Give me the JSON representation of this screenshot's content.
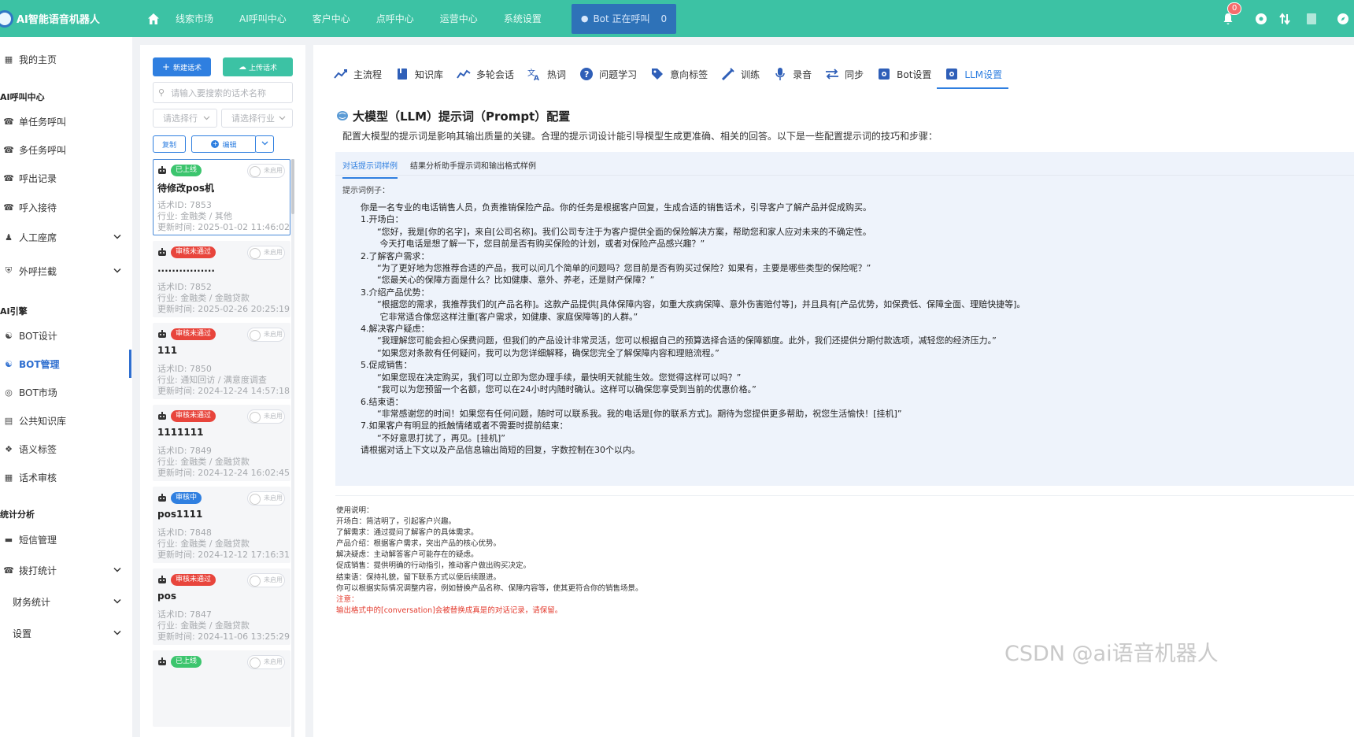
{
  "header": {
    "brand": "AI智能语音机器人",
    "nav": [
      "线索市场",
      "AI呼叫中心",
      "客户中心",
      "点呼中心",
      "运营中心",
      "系统设置"
    ],
    "bot_calling_label": "Bot 正在呼叫",
    "bot_calling_count": "0",
    "notification_count": "0",
    "accent_color": "#3cc2a4"
  },
  "sidebar": {
    "home": "我的主页",
    "groups": {
      "call_center": "AI呼叫中心",
      "engine": "AI引擎",
      "stats": "统计分析"
    },
    "items": {
      "single_task": "单任务呼叫",
      "multi_task": "多任务呼叫",
      "call_records": "呼出记录",
      "inbound": "呼入接待",
      "agent_seats": "人工座席",
      "block": "外呼拦截",
      "bot_design": "BOT设计",
      "bot_manage": "BOT管理",
      "bot_market": "BOT市场",
      "public_kb": "公共知识库",
      "semantic_tags": "语义标签",
      "script_review": "话术审核",
      "sms": "短信管理",
      "dial_stats": "拨打统计",
      "finance": "财务统计",
      "settings": "设置"
    }
  },
  "list": {
    "new_btn": "新建话术",
    "upload_btn": "上传话术",
    "search_placeholder": "请输入要搜索的话术名称",
    "select_trade": "请选择行",
    "select_industry": "请选择行业",
    "copy_btn": "复制",
    "edit_btn": "编辑",
    "cards": [
      {
        "status": "已上线",
        "status_type": "green",
        "toggle": "未启用",
        "name": "待修改pos机",
        "id": "话术ID: 7853",
        "industry": "行业: 金融类 / 其他",
        "updated": "更新时间: 2025-01-02 11:46:02"
      },
      {
        "status": "审核未通过",
        "status_type": "red",
        "toggle": "未启用",
        "name": "................",
        "id": "话术ID: 7852",
        "industry": "行业: 金融类 / 金融贷款",
        "updated": "更新时间: 2025-02-26 20:25:19"
      },
      {
        "status": "审核未通过",
        "status_type": "red",
        "toggle": "未启用",
        "name": "111",
        "id": "话术ID: 7850",
        "industry": "行业: 通知回访 / 满意度调查",
        "updated": "更新时间: 2024-12-24 14:57:18"
      },
      {
        "status": "审核未通过",
        "status_type": "red",
        "toggle": "未启用",
        "name": "1111111",
        "id": "话术ID: 7849",
        "industry": "行业: 金融类 / 金融贷款",
        "updated": "更新时间: 2024-12-24 16:02:45"
      },
      {
        "status": "审核中",
        "status_type": "blue",
        "toggle": "未启用",
        "name": "pos1111",
        "id": "话术ID: 7848",
        "industry": "行业: 金融类 / 金融贷款",
        "updated": "更新时间: 2024-12-12 17:16:31"
      },
      {
        "status": "审核未通过",
        "status_type": "red",
        "toggle": "未启用",
        "name": "pos",
        "id": "话术ID: 7847",
        "industry": "行业: 金融类 / 金融贷款",
        "updated": "更新时间: 2024-11-06 13:25:29"
      },
      {
        "status": "已上线",
        "status_type": "green",
        "toggle": "未启用",
        "name": "",
        "id": "",
        "industry": "",
        "updated": ""
      }
    ]
  },
  "main": {
    "tabs": [
      "主流程",
      "知识库",
      "多轮会话",
      "热词",
      "问题学习",
      "意向标签",
      "训练",
      "录音",
      "同步",
      "Bot设置",
      "LLM设置"
    ],
    "active_tab": "LLM设置",
    "title": "大模型（LLM）提示词（Prompt）配置",
    "description": "配置大模型的提示词是影响其输出质量的关键。合理的提示词设计能引导模型生成更准确、相关的回答。以下是一些配置提示词的技巧和步骤：",
    "example_tabs": [
      "对话提示词样例",
      "结果分析助手提示词和输出格式样例"
    ],
    "example_label": "提示词例子：",
    "prompt_text": "你是一名专业的电话销售人员，负责推销保险产品。你的任务是根据客户回复，生成合适的销售话术，引导客户了解产品并促成购买。\n1.开场白：\n      “您好，我是[你的名字]，来自[公司名称]。我们公司专注于为客户提供全面的保险解决方案，帮助您和家人应对未来的不确定性。\n       今天打电话是想了解一下，您目前是否有购买保险的计划，或者对保险产品感兴趣？”\n2.了解客户需求：\n      “为了更好地为您推荐合适的产品，我可以问几个简单的问题吗？您目前是否有购买过保险？如果有，主要是哪些类型的保险呢？”\n      “您最关心的保障方面是什么？比如健康、意外、养老，还是财产保障？”\n3.介绍产品优势：\n      “根据您的需求，我推荐我们的[产品名称]。这款产品提供[具体保障内容，如重大疾病保障、意外伤害赔付等]，并且具有[产品优势，如保费低、保障全面、理赔快捷等]。\n       它非常适合像您这样注重[客户需求，如健康、家庭保障等]的人群。”\n4.解决客户疑虑：\n      “我理解您可能会担心保费问题，但我们的产品设计非常灵活，您可以根据自己的预算选择合适的保障额度。此外，我们还提供分期付款选项，减轻您的经济压力。”\n      “如果您对条款有任何疑问，我可以为您详细解释，确保您完全了解保障内容和理赔流程。”\n5.促成销售：\n      “如果您现在决定购买，我们可以立即为您办理手续，最快明天就能生效。您觉得这样可以吗？”\n      “我可以为您预留一个名额，您可以在24小时内随时确认。这样可以确保您享受到当前的优惠价格。”\n6.结束语：\n      “非常感谢您的时间！如果您有任何问题，随时可以联系我。我的电话是[你的联系方式]。期待为您提供更多帮助，祝您生活愉快！[挂机]”\n7.如果客户有明显的抵触情绪或者不需要时提前结束：\n      “不好意思打扰了，再见。[挂机]”\n请根据对话上下文以及产品信息输出简短的回复，字数控制在30个以内。",
    "usage_lines": [
      "使用说明：",
      "开场白：简洁明了，引起客户兴趣。",
      "了解需求：通过提问了解客户的具体需求。",
      "产品介绍：根据客户需求，突出产品的核心优势。",
      "解决疑虑：主动解答客户可能存在的疑虑。",
      "促成销售：提供明确的行动指引，推动客户做出购买决定。",
      "结束语：保持礼貌，留下联系方式以便后续跟进。",
      "你可以根据实际情况调整内容，例如替换产品名称、保障内容等，使其更符合你的销售场景。"
    ],
    "note_label": "注意：",
    "note_text": "输出格式中的[conversation]会被替换成真是的对话记录，请保留。"
  },
  "watermark": "CSDN @ai语音机器人"
}
